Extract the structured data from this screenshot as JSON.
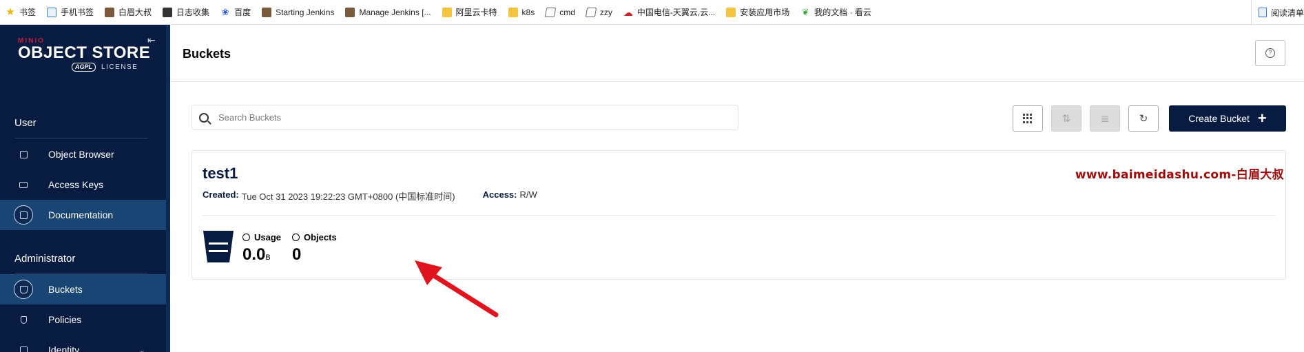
{
  "bookmarks": [
    {
      "label": "书签",
      "icon": "star-icon"
    },
    {
      "label": "手机书签",
      "icon": "page-icon"
    },
    {
      "label": "白眉大叔",
      "icon": "person-icon"
    },
    {
      "label": "日志收集",
      "icon": "circle-icon"
    },
    {
      "label": "百度",
      "icon": "paw-icon"
    },
    {
      "label": "Starting Jenkins",
      "icon": "jenkins-icon"
    },
    {
      "label": "Manage Jenkins [...",
      "icon": "jenkins-icon"
    },
    {
      "label": "阿里云卡特",
      "icon": "folder-icon"
    },
    {
      "label": "k8s",
      "icon": "folder-icon"
    },
    {
      "label": "cmd",
      "icon": "doc-icon"
    },
    {
      "label": "zzy",
      "icon": "doc-icon"
    },
    {
      "label": "中国电信-天翼云,云...",
      "icon": "cloud-icon"
    },
    {
      "label": "安装应用市场",
      "icon": "folder-icon"
    },
    {
      "label": "我的文档 · 看云",
      "icon": "leaf-icon"
    }
  ],
  "bookmarks_right": "阅读清单",
  "sidebar": {
    "brand_small": "MINIO",
    "brand_large": "OBJECT STORE",
    "license_badge": "AGPL",
    "license_text": "LICENSE",
    "user_section": "User",
    "admin_section": "Administrator",
    "items": [
      {
        "label": "Object Browser"
      },
      {
        "label": "Access Keys"
      },
      {
        "label": "Documentation"
      },
      {
        "label": "Buckets"
      },
      {
        "label": "Policies"
      },
      {
        "label": "Identity"
      }
    ]
  },
  "header": {
    "title": "Buckets",
    "help": "?"
  },
  "search": {
    "placeholder": "Search Buckets",
    "value": ""
  },
  "toolbar": {
    "create_label": "Create Bucket"
  },
  "bucket": {
    "name": "test1",
    "created_label": "Created:",
    "created_value": "Tue Oct 31 2023 19:22:23 GMT+0800 (中国标准时间)",
    "access_label": "Access:",
    "access_value": "R/W",
    "usage_label": "Usage",
    "usage_value": "0.0",
    "usage_unit": "B",
    "objects_label": "Objects",
    "objects_value": "0"
  },
  "watermark": "www.baimeidashu.com-白眉大叔",
  "colors": {
    "navy": "#081c42",
    "active": "#184574",
    "arrow": "#e0141e",
    "watermark": "#a00c0c"
  }
}
